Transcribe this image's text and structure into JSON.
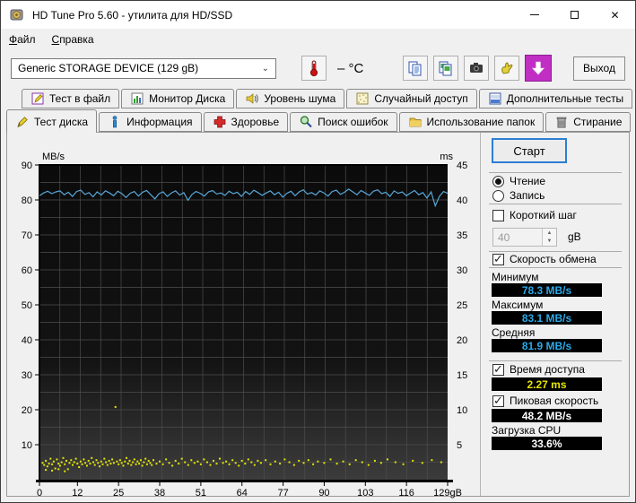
{
  "window": {
    "title": "HD Tune Pro 5.60 - утилита для HD/SSD",
    "controls": {
      "minimize": "minimize",
      "maximize": "maximize",
      "close": "✕"
    }
  },
  "menu": {
    "items": [
      {
        "accel": "Ф",
        "rest": "айл"
      },
      {
        "accel": "С",
        "rest": "правка"
      }
    ]
  },
  "toolbar": {
    "device_select": {
      "value": "Generic STORAGE DEVICE (129 gB)"
    },
    "temperature": {
      "value": "–",
      "unit": "°C"
    },
    "buttons": [
      "temperature",
      "copy-text",
      "copy-image",
      "screenshot",
      "hand-tool",
      "save"
    ],
    "exit_label": "Выход"
  },
  "tabs": {
    "active": "Тест диска",
    "row1": [
      {
        "label": "Тест в файл"
      },
      {
        "label": "Монитор Диска"
      },
      {
        "label": "Уровень шума"
      },
      {
        "label": "Случайный доступ"
      },
      {
        "label": "Дополнительные тесты"
      }
    ],
    "row2": [
      {
        "label": "Тест диска"
      },
      {
        "label": "Информация"
      },
      {
        "label": "Здоровье"
      },
      {
        "label": "Поиск ошибок"
      },
      {
        "label": "Использование папок"
      },
      {
        "label": "Стирание"
      }
    ]
  },
  "controls": {
    "start_label": "Старт",
    "mode": {
      "options": [
        {
          "label": "Чтение",
          "selected": true
        },
        {
          "label": "Запись",
          "selected": false
        }
      ]
    },
    "short_stride": {
      "label": "Короткий шаг",
      "checked": false,
      "value": "40",
      "unit": "gB"
    },
    "transfer": {
      "label": "Скорость обмена",
      "checked": true,
      "stats": [
        {
          "label": "Минимум",
          "value": "78.3 MB/s",
          "color": "#2aa9e8"
        },
        {
          "label": "Максимум",
          "value": "83.1 MB/s",
          "color": "#2aa9e8"
        },
        {
          "label": "Средняя",
          "value": "81.9 MB/s",
          "color": "#2aa9e8"
        }
      ]
    },
    "access_time": {
      "label": "Время доступа",
      "checked": true,
      "value": "2.27 ms",
      "color": "#e6e400"
    },
    "burst_rate": {
      "label": "Пиковая скорость",
      "checked": true,
      "value": "48.2 MB/s",
      "color": "#ffffff"
    },
    "cpu": {
      "label": "Загрузка CPU",
      "value": "33.6%",
      "color": "#ffffff"
    }
  },
  "chart_data": {
    "type": "line",
    "title": "",
    "x_axis": {
      "min": 0,
      "max": 129,
      "unit": "gB",
      "tick_values": [
        0,
        12,
        25,
        38,
        51,
        64,
        77,
        90,
        103,
        116,
        129
      ],
      "tick_labels": [
        "0",
        "12",
        "25",
        "38",
        "51",
        "64",
        "77",
        "90",
        "103",
        "116",
        "129gB"
      ]
    },
    "left_axis": {
      "label": "MB/s",
      "min": 0,
      "max": 90,
      "ticks": [
        90,
        80,
        70,
        60,
        50,
        40,
        30,
        20,
        10
      ]
    },
    "right_axis": {
      "label": "ms",
      "min": 0,
      "max": 45,
      "ticks": [
        45,
        40,
        35,
        30,
        25,
        20,
        15,
        10,
        5
      ]
    },
    "grid": {
      "x_divisions": 20,
      "y_divisions": 18,
      "on": true
    },
    "legend": "none",
    "series": [
      {
        "name": "transfer-rate",
        "type": "line",
        "axis": "left",
        "color": "#58a6d8",
        "unit": "MB/s",
        "stats": {
          "min": 78.3,
          "max": 83.1,
          "avg": 81.9
        },
        "y_values": [
          81.2,
          82.0,
          82.5,
          81.8,
          82.3,
          82.6,
          81.5,
          82.2,
          81.0,
          82.4,
          82.8,
          81.6,
          82.1,
          80.9,
          82.3,
          81.4,
          82.6,
          82.0,
          81.2,
          82.5,
          81.8,
          80.7,
          81.9,
          82.4,
          81.1,
          82.2,
          82.7,
          81.5,
          80.3,
          81.8,
          82.3,
          81.0,
          82.0,
          82.6,
          81.4,
          82.1,
          79.9,
          81.6,
          82.4,
          81.9,
          81.1,
          82.3,
          82.7,
          81.7,
          82.0,
          81.3,
          82.5,
          81.8,
          82.2,
          81.0,
          82.4,
          81.6,
          82.8,
          82.1,
          81.3,
          82.0,
          82.6,
          81.5,
          82.2,
          80.8,
          81.9,
          82.5,
          81.2,
          82.3,
          82.9,
          81.7,
          82.1,
          81.4,
          82.6,
          82.0,
          81.1,
          82.4,
          82.8,
          81.6,
          82.2,
          83.1,
          82.3,
          81.5,
          82.7,
          82.0,
          81.3,
          82.5,
          82.9,
          81.8,
          82.2,
          81.0,
          82.6,
          81.9,
          82.3,
          81.2,
          82.0,
          82.7,
          81.5,
          82.1,
          80.5,
          82.3,
          78.3,
          81.0,
          82.4,
          81.9
        ]
      },
      {
        "name": "access-time",
        "type": "scatter",
        "axis": "right",
        "color": "#e6e600",
        "unit": "ms",
        "stats": {
          "avg": 2.27
        },
        "points": [
          [
            1,
            2.4
          ],
          [
            1.5,
            2.1
          ],
          [
            2,
            2.7
          ],
          [
            2,
            1.4
          ],
          [
            2.5,
            1.9
          ],
          [
            3,
            2.3
          ],
          [
            3.5,
            3.0
          ],
          [
            4,
            2.2
          ],
          [
            4,
            1.3
          ],
          [
            4.5,
            2.6
          ],
          [
            5,
            1.6
          ],
          [
            5.5,
            2.9
          ],
          [
            6,
            2.3
          ],
          [
            6,
            1.5
          ],
          [
            6.5,
            2.0
          ],
          [
            7,
            2.5
          ],
          [
            7.5,
            3.1
          ],
          [
            8,
            2.2
          ],
          [
            8,
            1.2
          ],
          [
            8.5,
            2.7
          ],
          [
            9,
            1.5
          ],
          [
            9.5,
            2.4
          ],
          [
            10,
            2.8
          ],
          [
            10.5,
            2.1
          ],
          [
            11,
            2.5
          ],
          [
            11.5,
            3.0
          ],
          [
            12,
            2.3
          ],
          [
            12.5,
            1.8
          ],
          [
            13,
            2.6
          ],
          [
            13.5,
            2.2
          ],
          [
            14,
            2.9
          ],
          [
            14.5,
            2.4
          ],
          [
            15,
            2.0
          ],
          [
            15.5,
            2.7
          ],
          [
            16,
            2.3
          ],
          [
            16.5,
            3.1
          ],
          [
            17,
            2.5
          ],
          [
            17.5,
            2.1
          ],
          [
            18,
            2.8
          ],
          [
            18.5,
            2.4
          ],
          [
            19,
            1.9
          ],
          [
            19.5,
            2.6
          ],
          [
            20,
            2.2
          ],
          [
            20.5,
            3.0
          ],
          [
            21,
            2.5
          ],
          [
            21.5,
            2.1
          ],
          [
            22,
            2.7
          ],
          [
            22.5,
            2.3
          ],
          [
            23,
            2.9
          ],
          [
            23.5,
            2.4
          ],
          [
            24,
            10.4
          ],
          [
            24.5,
            2.6
          ],
          [
            25,
            2.2
          ],
          [
            25.5,
            2.8
          ],
          [
            26,
            2.4
          ],
          [
            26.5,
            2.0
          ],
          [
            27,
            2.6
          ],
          [
            27.5,
            3.1
          ],
          [
            28,
            2.3
          ],
          [
            28.5,
            2.7
          ],
          [
            29,
            2.1
          ],
          [
            29.5,
            2.5
          ],
          [
            30,
            2.9
          ],
          [
            30.5,
            2.2
          ],
          [
            31,
            2.6
          ],
          [
            31.5,
            2.3
          ],
          [
            32,
            2.8
          ],
          [
            32.5,
            2.0
          ],
          [
            33,
            2.5
          ],
          [
            33.5,
            3.0
          ],
          [
            34,
            2.2
          ],
          [
            34.5,
            2.7
          ],
          [
            35,
            2.4
          ],
          [
            35.5,
            2.1
          ],
          [
            36,
            2.8
          ],
          [
            37,
            2.3
          ],
          [
            38,
            2.6
          ],
          [
            39,
            2.2
          ],
          [
            40,
            2.9
          ],
          [
            41,
            2.4
          ],
          [
            42,
            2.0
          ],
          [
            43,
            2.7
          ],
          [
            44,
            2.3
          ],
          [
            45,
            3.0
          ],
          [
            46,
            2.5
          ],
          [
            47,
            2.1
          ],
          [
            48,
            2.8
          ],
          [
            49,
            2.4
          ],
          [
            50,
            2.6
          ],
          [
            51,
            2.2
          ],
          [
            52,
            2.9
          ],
          [
            53,
            2.5
          ],
          [
            54,
            2.1
          ],
          [
            55,
            2.7
          ],
          [
            56,
            2.3
          ],
          [
            57,
            3.0
          ],
          [
            58,
            2.4
          ],
          [
            59,
            2.6
          ],
          [
            60,
            2.2
          ],
          [
            61,
            2.8
          ],
          [
            62,
            2.4
          ],
          [
            63,
            2.0
          ],
          [
            64,
            2.7
          ],
          [
            65,
            2.3
          ],
          [
            66,
            2.9
          ],
          [
            67,
            2.5
          ],
          [
            68,
            2.1
          ],
          [
            69,
            2.7
          ],
          [
            70,
            2.4
          ],
          [
            71.5,
            2.8
          ],
          [
            73,
            2.2
          ],
          [
            74.5,
            2.6
          ],
          [
            76,
            2.3
          ],
          [
            77.5,
            2.9
          ],
          [
            79,
            2.5
          ],
          [
            80.5,
            2.1
          ],
          [
            82,
            2.7
          ],
          [
            83.5,
            2.4
          ],
          [
            85,
            2.8
          ],
          [
            86.5,
            2.2
          ],
          [
            88,
            2.6
          ],
          [
            90,
            2.4
          ],
          [
            92,
            2.9
          ],
          [
            94,
            2.3
          ],
          [
            96,
            2.6
          ],
          [
            98,
            2.2
          ],
          [
            100,
            2.8
          ],
          [
            102,
            2.5
          ],
          [
            104,
            2.1
          ],
          [
            106,
            2.7
          ],
          [
            108,
            2.4
          ],
          [
            110,
            2.9
          ],
          [
            112.5,
            2.5
          ],
          [
            115,
            2.2
          ],
          [
            118,
            2.7
          ],
          [
            121,
            2.4
          ],
          [
            124,
            2.8
          ],
          [
            127,
            2.5
          ]
        ]
      }
    ]
  },
  "colors": {
    "plot_background_top": "#0b0b0b",
    "plot_background_bottom": "#3c3c3c",
    "grid": "#4e4e4e",
    "transfer_line": "#58a6d8",
    "access_dots": "#e6e600",
    "value_cyan": "#2aa9e8",
    "value_yellow": "#e6e400",
    "save_button": "#c02ec4"
  }
}
